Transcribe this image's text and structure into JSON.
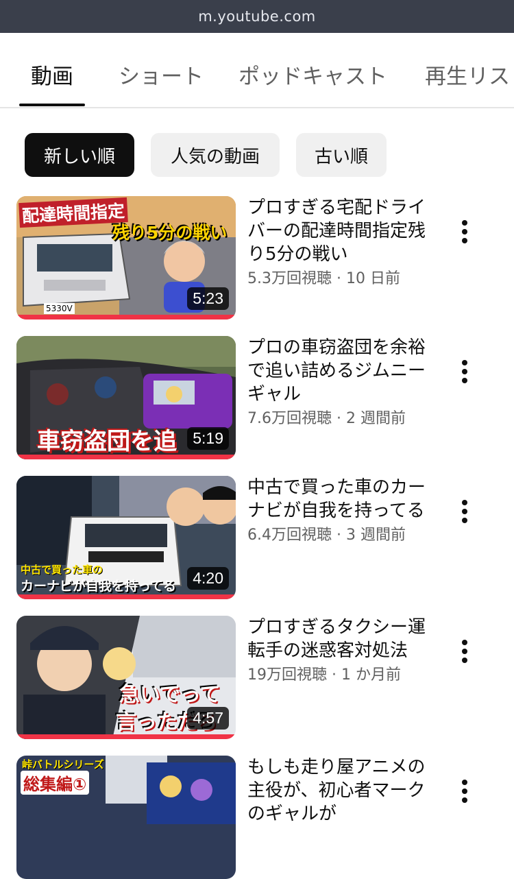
{
  "browser": {
    "url": "m.youtube.com"
  },
  "tabs": [
    {
      "label": "動画",
      "active": true
    },
    {
      "label": "ショート",
      "active": false
    },
    {
      "label": "ポッドキャスト",
      "active": false
    },
    {
      "label": "再生リス",
      "active": false
    }
  ],
  "filters": [
    {
      "label": "新しい順",
      "selected": true
    },
    {
      "label": "人気の動画",
      "selected": false
    },
    {
      "label": "古い順",
      "selected": false
    }
  ],
  "videos": [
    {
      "title": "プロすぎる宅配ドライバーの配達時間指定残り5分の戦い",
      "meta": "5.3万回視聴 · 10 日前",
      "duration": "5:23",
      "thumb_text": [
        "配達時間指定",
        "残り5分の戦い"
      ],
      "plate": "5330V",
      "watched": 1.0
    },
    {
      "title": "プロの車窃盗団を余裕で追い詰めるジムニーギャル",
      "meta": "7.6万回視聴 · 2 週間前",
      "duration": "5:19",
      "thumb_text": [
        "車窃盗団を追"
      ],
      "watched": 1.0
    },
    {
      "title": "中古で買った車のカーナビが自我を持ってる",
      "meta": "6.4万回視聴 · 3 週間前",
      "duration": "4:20",
      "thumb_text": [
        "中古で買った車の",
        "カーナビが自我を持ってる"
      ],
      "watched": 1.0
    },
    {
      "title": "プロすぎるタクシー運転手の迷惑客対処法",
      "meta": "19万回視聴 · 1 か月前",
      "duration": "4:57",
      "thumb_text": [
        "急いでって",
        "言っただろ"
      ],
      "watched": 1.0
    },
    {
      "title": "もしも走り屋アニメの主役が、初心者マークのギャルが",
      "meta": "",
      "duration": "",
      "thumb_text": [
        "峠バトルシリーズ",
        "総集編①"
      ],
      "watched": 0
    }
  ]
}
